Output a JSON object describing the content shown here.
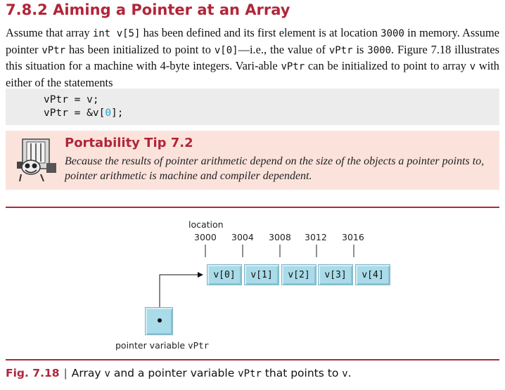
{
  "section": {
    "heading": "7.8.2 Aiming a Pointer at an Array"
  },
  "paragraph": {
    "t1": "Assume that array ",
    "c1": "int v[5]",
    "t2": " has been defined and its first element is at location ",
    "c2": "3000",
    "t3": " in memory. Assume pointer ",
    "c3": "vPtr",
    "t4": " has been initialized to point to ",
    "c4": "v[0]",
    "t5": "—i.e., the value of ",
    "c5": "vPtr",
    "t6": " is ",
    "c6": "3000",
    "t7": ". Figure 7.18 illustrates this situation for a machine with 4-byte integers. Vari-able ",
    "c7": "vPtr",
    "t8": " can be initialized to point to array ",
    "c8": "v",
    "t9": " with either of the statements"
  },
  "code": {
    "line1": "vPtr = v;",
    "line2_a": "vPtr = &v[",
    "line2_b": "0",
    "line2_c": "];"
  },
  "tip": {
    "title": "Portability Tip 7.2",
    "body": "Because the results of pointer arithmetic depend on the size of the objects a pointer points to, pointer arithmetic is machine and compiler dependent."
  },
  "figure": {
    "location_label": "location",
    "addresses": [
      "3000",
      "3004",
      "3008",
      "3012",
      "3016"
    ],
    "cells": [
      "v[0]",
      "v[1]",
      "v[2]",
      "v[3]",
      "v[4]"
    ],
    "pointer_label_text": "pointer variable ",
    "pointer_label_code": "vPtr"
  },
  "caption": {
    "label": "Fig. 7.18",
    "separator": "|",
    "t1": "Array ",
    "c1": "v",
    "t2": " and a pointer variable ",
    "c2": "vPtr",
    "t3": " that points to ",
    "c3": "v",
    "t4": "."
  },
  "colors": {
    "accent": "#b0263a",
    "cell_fill": "#a9dbe9",
    "tip_background": "#fbe3dc",
    "code_background": "#ececec"
  }
}
